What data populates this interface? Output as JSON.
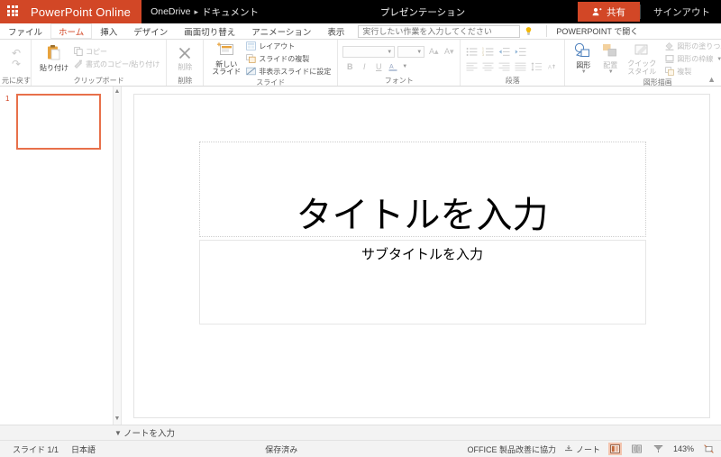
{
  "titlebar": {
    "app_launcher_icon": "waffle-grid-icon",
    "brand": "PowerPoint Online",
    "breadcrumb_root": "OneDrive",
    "breadcrumb_sep": "▸",
    "breadcrumb_folder": "ドキュメント",
    "document_title": "プレゼンテーション",
    "share_label": "共有",
    "share_icon": "person-share-icon",
    "signout_label": "サインアウト",
    "brand_color": "#D24726",
    "bar_color": "#000000"
  },
  "tabs": [
    {
      "label": "ファイル",
      "active": false
    },
    {
      "label": "ホーム",
      "active": true
    },
    {
      "label": "挿入",
      "active": false
    },
    {
      "label": "デザイン",
      "active": false
    },
    {
      "label": "画面切り替え",
      "active": false
    },
    {
      "label": "アニメーション",
      "active": false
    },
    {
      "label": "表示",
      "active": false
    }
  ],
  "tellme": {
    "placeholder": "実行したい作業を入力してください",
    "value": "",
    "bulb_icon": "lightbulb-icon",
    "open_in_app": "POWERPOINT で開く"
  },
  "ribbon": {
    "collapse_icon": "chevron-up-icon",
    "groups": [
      {
        "name": "undo",
        "label": "元に戻す",
        "undo_icon": "undo-arrow-icon",
        "redo_icon": "redo-arrow-icon"
      },
      {
        "name": "clipboard",
        "label": "クリップボード",
        "paste_label": "貼り付け",
        "paste_icon": "clipboard-paste-icon",
        "copy_label": "コピー",
        "copy_icon": "copy-icon",
        "format_painter_label": "書式のコピー/貼り付け",
        "format_painter_icon": "format-painter-icon"
      },
      {
        "name": "delete",
        "label": "削除",
        "delete_label": "削除",
        "delete_icon": "delete-x-icon"
      },
      {
        "name": "slides",
        "label": "スライド",
        "new_slide_label_line1": "新しい",
        "new_slide_label_line2": "スライド",
        "new_slide_icon": "new-slide-icon",
        "layout_label": "レイアウト",
        "layout_icon": "layout-icon",
        "duplicate_label": "スライドの複製",
        "duplicate_icon": "duplicate-slide-icon",
        "hide_label": "非表示スライドに設定",
        "hide_icon": "hide-slide-icon"
      },
      {
        "name": "font",
        "label": "フォント",
        "font_name_value": "",
        "font_size_value": "",
        "grow_font_icon": "grow-font-icon",
        "shrink_font_icon": "shrink-font-icon",
        "bold_icon": "bold-icon",
        "italic_icon": "italic-icon",
        "underline_icon": "underline-icon",
        "font_color_icon": "font-color-icon"
      },
      {
        "name": "paragraph",
        "label": "段落",
        "bullets_icon": "bullet-list-icon",
        "numbering_icon": "numbered-list-icon",
        "decrease_indent_icon": "decrease-indent-icon",
        "increase_indent_icon": "increase-indent-icon",
        "align_left_icon": "align-left-icon",
        "align_center_icon": "align-center-icon",
        "align_right_icon": "align-right-icon",
        "justify_icon": "justify-icon",
        "line_spacing_icon": "line-spacing-icon",
        "text_direction_icon": "text-direction-icon"
      },
      {
        "name": "drawing",
        "label": "図形描画",
        "shapes_label": "図形",
        "shapes_icon": "shapes-icon",
        "arrange_label": "配置",
        "arrange_icon": "arrange-icon",
        "quick_styles_label_line1": "クイック",
        "quick_styles_label_line2": "スタイル",
        "quick_styles_icon": "quick-styles-icon",
        "shape_fill_label": "図形の塗りつぶし",
        "shape_fill_icon": "shape-fill-icon",
        "shape_outline_label": "図形の枠線",
        "shape_outline_icon": "shape-outline-icon",
        "shape_duplicate_label": "複製",
        "shape_duplicate_icon": "shape-duplicate-icon"
      }
    ]
  },
  "thumbnails": {
    "slides": [
      {
        "number": "1",
        "selected": true
      }
    ],
    "selection_color": "#E8704A"
  },
  "splitter": {
    "up_icon": "chevron-up-icon",
    "down_icon": "chevron-down-icon"
  },
  "slide": {
    "title_placeholder": "タイトルを入力",
    "subtitle_placeholder": "サブタイトルを入力"
  },
  "notes": {
    "chevron_icon": "chevron-down-icon",
    "placeholder": "ノートを入力"
  },
  "statusbar": {
    "slide_counter": "スライド 1/1",
    "language": "日本語",
    "save_state": "保存済み",
    "feedback": "OFFICE 製品改善に協力",
    "notes_label": "ノート",
    "notes_icon": "notes-icon",
    "views": [
      {
        "name": "editing-view",
        "icon": "normal-view-icon",
        "selected": true
      },
      {
        "name": "reading-view",
        "icon": "reading-view-icon",
        "selected": false
      },
      {
        "name": "slideshow-view",
        "icon": "slideshow-view-icon",
        "selected": false
      }
    ],
    "zoom": "143%",
    "fit_icon": "fit-slide-icon",
    "view_selected_color": "#F3C4AE"
  }
}
